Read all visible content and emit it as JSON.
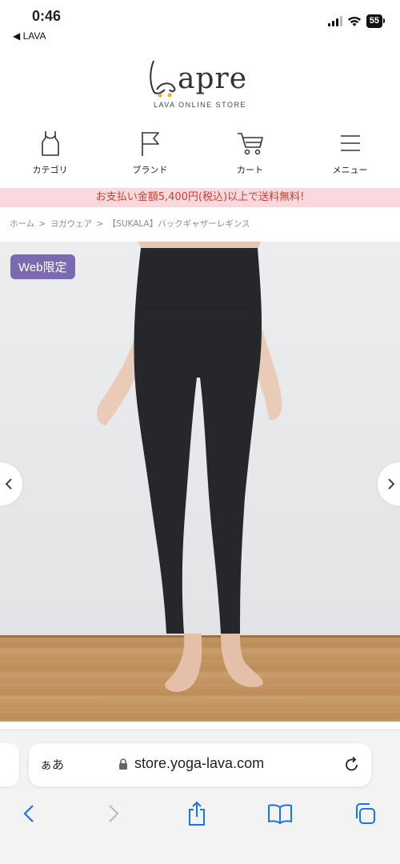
{
  "status": {
    "time": "0:46",
    "back_label": "◀ LAVA",
    "battery": "55"
  },
  "logo": {
    "wordmark": "apre",
    "subtitle": "LAVA ONLINE STORE"
  },
  "nav": [
    {
      "label": "カテゴリ",
      "icon": "tank-top-icon"
    },
    {
      "label": "ブランド",
      "icon": "flag-icon"
    },
    {
      "label": "カート",
      "icon": "cart-icon"
    },
    {
      "label": "メニュー",
      "icon": "hamburger-menu-icon"
    }
  ],
  "banner": {
    "text": "お支払い金額5,400円(税込)以上で送料無料!"
  },
  "breadcrumb": {
    "home": "ホーム",
    "category": "ヨガウェア",
    "product": "【SUKALA】バックギャザーレギンス",
    "separator": ">"
  },
  "product_image": {
    "badge": "Web限定"
  },
  "safari": {
    "text_size_label": "ぁあ",
    "url": "store.yoga-lava.com"
  },
  "colors": {
    "banner_bg": "#f9d9dd",
    "banner_text": "#c2433a",
    "badge_bg": "#7a6ab0",
    "safari_accent": "#1a73e8"
  }
}
